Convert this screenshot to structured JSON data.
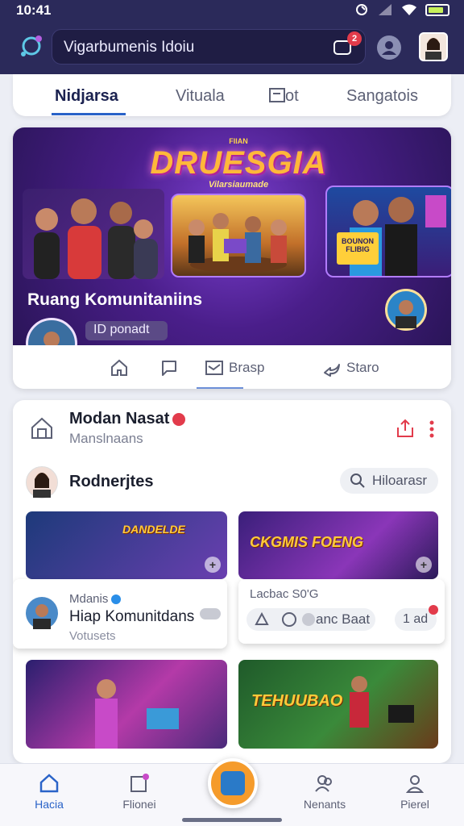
{
  "status_bar": {
    "time": "10:41"
  },
  "header": {
    "search_text": "Vigarbumenis Idoiu",
    "notification_count": "2"
  },
  "tabs": [
    {
      "label": "Nidjarsa",
      "active": true
    },
    {
      "label": "Vituala",
      "active": false
    },
    {
      "label": "ot",
      "active": false
    },
    {
      "label": "Sangatois",
      "active": false
    }
  ],
  "hero": {
    "logo_small": "FIIAN",
    "logo_big": "DRUESGIA",
    "logo_sub": "Vilarsiaumade",
    "right_sign": "BOUNON FLIBIG",
    "title": "Ruang Komunitaniins",
    "pill": "ID ponadt",
    "actions": [
      {
        "icon": "home-icon",
        "label": ""
      },
      {
        "icon": "chat-icon",
        "label": ""
      },
      {
        "icon": "message-icon",
        "label": "Brasp"
      },
      {
        "icon": "share-icon",
        "label": "Staro"
      }
    ]
  },
  "community": {
    "title": "Modan Nasat",
    "subtitle": "Manslnaans",
    "user_name": "Rodnerjtes",
    "filter_button": "Hiloarasr",
    "tiles": [
      {
        "title": "DANDELDE"
      },
      {
        "title": "CKGMIS FOENG"
      },
      {
        "title": ""
      },
      {
        "title": "TEHUUBAO"
      }
    ],
    "card_left": {
      "label": "Mdanis",
      "title": "Hiap Komunitdans",
      "subtitle": "Votusets"
    },
    "card_right": {
      "label": "Lacbac S0'G",
      "text": "anc Baat",
      "pill": "1 ad"
    }
  },
  "bottom_nav": [
    {
      "label": "Hacia",
      "active": true
    },
    {
      "label": "Flionei",
      "active": false
    },
    {
      "label": "Nenants",
      "active": false
    },
    {
      "label": "Pierel",
      "active": false
    }
  ],
  "colors": {
    "header_bg": "#2b2a5a",
    "accent_blue": "#2a63c8",
    "badge_red": "#e23b4b",
    "fab_orange": "#f59b2b"
  }
}
